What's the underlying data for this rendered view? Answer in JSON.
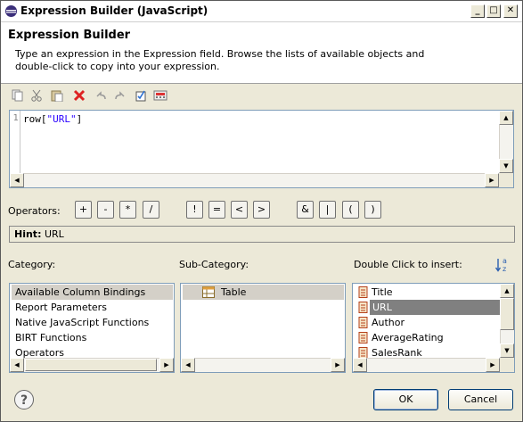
{
  "window": {
    "title": "Expression Builder (JavaScript)",
    "controls": [
      "_",
      "□",
      "✕"
    ]
  },
  "header": {
    "title": "Expression Builder",
    "description": "Type an expression in the Expression field. Browse the lists of available objects and double-click to copy into your expression."
  },
  "toolbar": {
    "icons": [
      "copy-icon",
      "cut-icon",
      "paste-icon",
      "delete-icon",
      "undo-icon",
      "redo-icon",
      "validate-icon",
      "calculator-icon"
    ]
  },
  "editor": {
    "line_number": "1",
    "code_prefix": "row[",
    "code_string": "\"URL\"",
    "code_suffix": "]"
  },
  "operators": {
    "label": "Operators:",
    "buttons": [
      "+",
      "-",
      "*",
      "/",
      "!",
      "=",
      "<",
      ">",
      "&",
      "|",
      "(",
      ")"
    ]
  },
  "hint": {
    "label": "Hint:",
    "value": "URL"
  },
  "category": {
    "label": "Category:",
    "items": [
      "Available Column Bindings",
      "Report Parameters",
      "Native JavaScript Functions",
      "BIRT Functions",
      "Operators"
    ],
    "selected_index": 0
  },
  "subcategory": {
    "label": "Sub-Category:",
    "items": [
      "Table"
    ]
  },
  "insert": {
    "label": "Double Click to insert:",
    "items": [
      "Title",
      "URL",
      "Author",
      "AverageRating",
      "SalesRank"
    ],
    "selected_index": 1
  },
  "buttons": {
    "help": "?",
    "ok": "OK",
    "cancel": "Cancel"
  },
  "colors": {
    "selection": "#d4d0c8",
    "string_literal": "#2a00ff",
    "dialog_bg": "#ece9d8"
  }
}
